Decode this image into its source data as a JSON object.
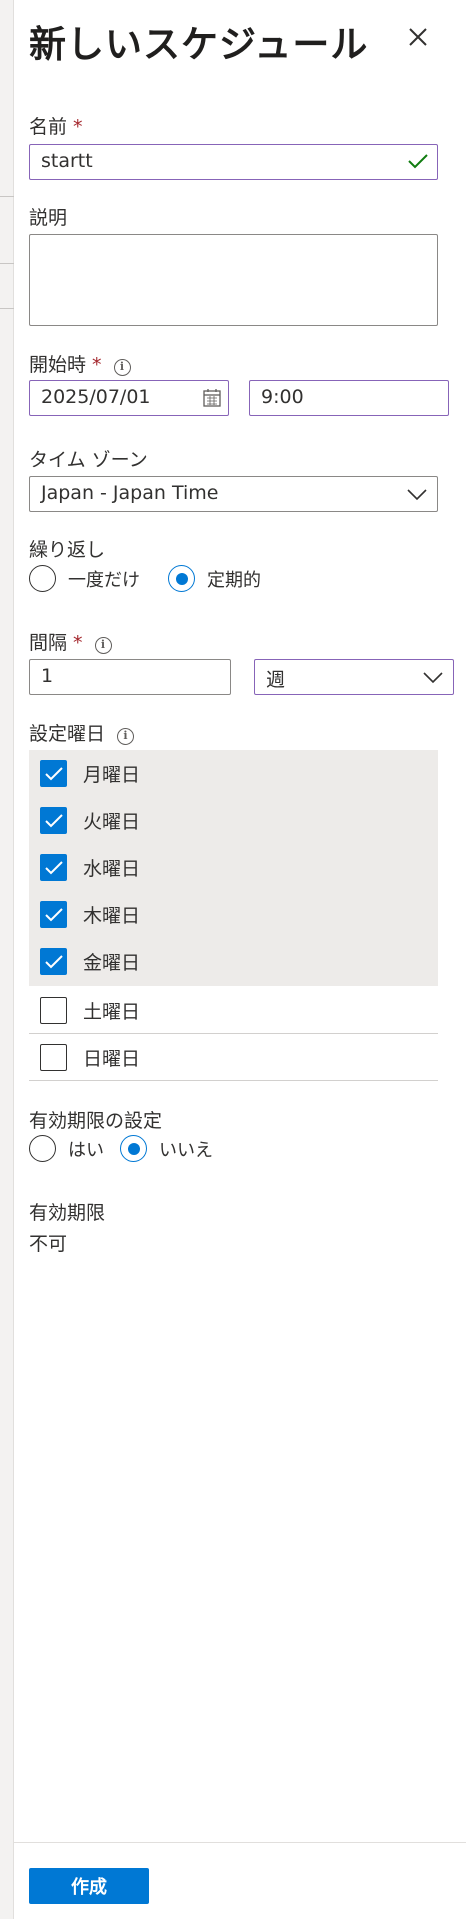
{
  "panel": {
    "title": "新しいスケジュール"
  },
  "name": {
    "label": "名前",
    "required_mark": "*",
    "value": "startt"
  },
  "description": {
    "label": "説明",
    "value": ""
  },
  "start_time": {
    "label": "開始時",
    "required_mark": "*",
    "info_glyph": "i",
    "date_value": "2025/07/01",
    "time_value": "9:00"
  },
  "timezone": {
    "label": "タイム ゾーン",
    "selected": "Japan - Japan Time"
  },
  "recurrence": {
    "label": "繰り返し",
    "options": [
      {
        "label": "一度だけ",
        "checked": false
      },
      {
        "label": "定期的",
        "checked": true
      }
    ]
  },
  "interval": {
    "label": "間隔",
    "required_mark": "*",
    "info_glyph": "i",
    "value": "1",
    "unit_selected": "週"
  },
  "weekdays": {
    "label": "設定曜日",
    "info_glyph": "i",
    "days": [
      {
        "label": "月曜日",
        "checked": true
      },
      {
        "label": "火曜日",
        "checked": true
      },
      {
        "label": "水曜日",
        "checked": true
      },
      {
        "label": "木曜日",
        "checked": true
      },
      {
        "label": "金曜日",
        "checked": true
      },
      {
        "label": "土曜日",
        "checked": false
      },
      {
        "label": "日曜日",
        "checked": false
      }
    ]
  },
  "expiration_setting": {
    "label": "有効期限の設定",
    "options": [
      {
        "label": "はい",
        "checked": false
      },
      {
        "label": "いいえ",
        "checked": true
      }
    ]
  },
  "expiration": {
    "label": "有効期限",
    "value": "不可"
  },
  "footer": {
    "create_label": "作成"
  },
  "colors": {
    "accent": "#0078d4",
    "active_border": "#8764b8",
    "required": "#a4262c",
    "valid_check": "#107c10"
  }
}
